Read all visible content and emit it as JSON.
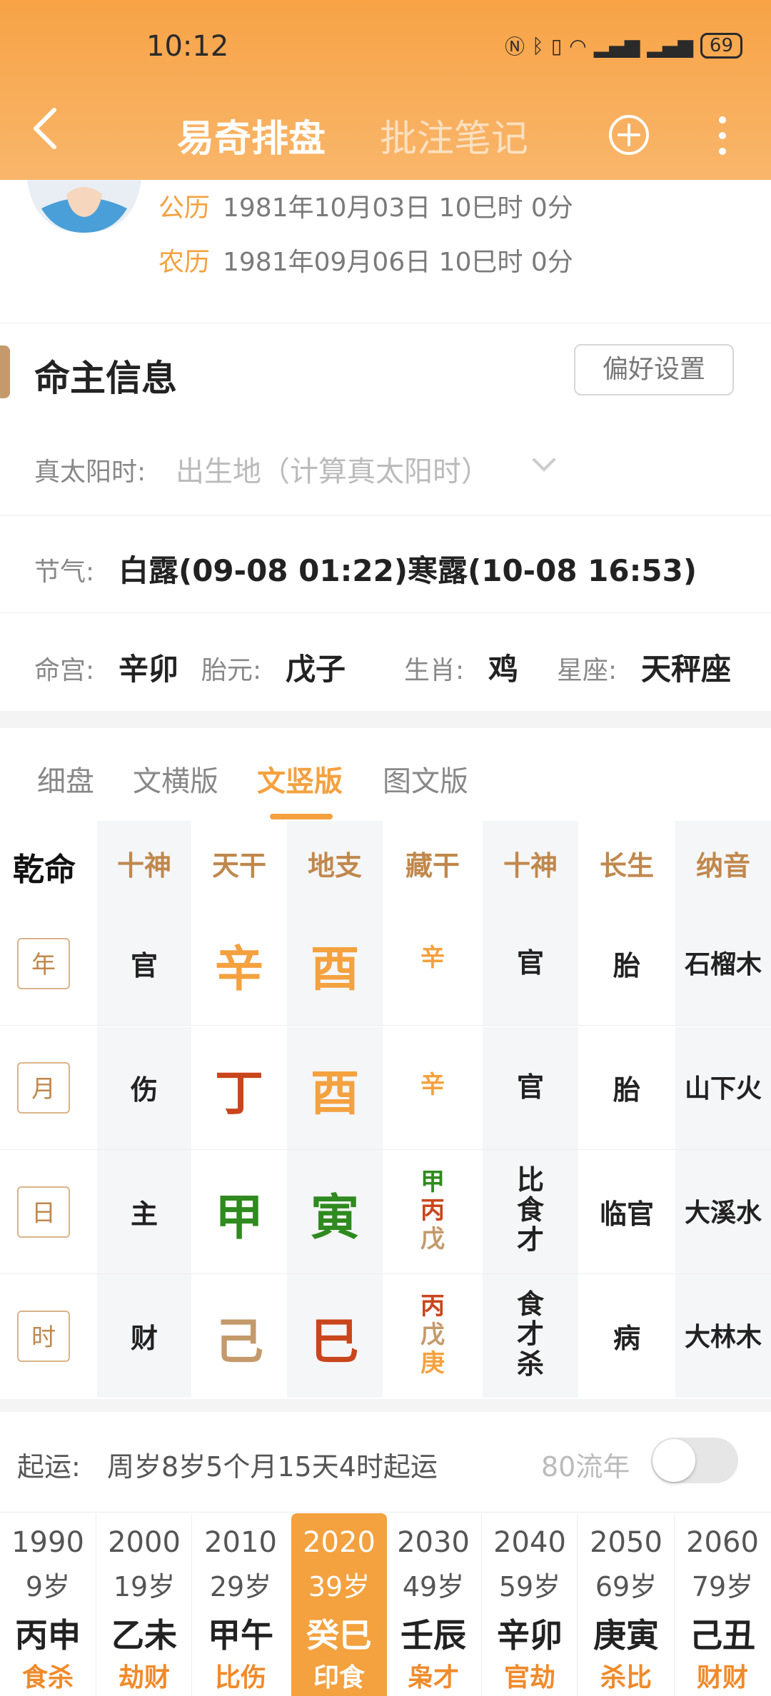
{
  "status": {
    "time": "10:12",
    "battery": "69"
  },
  "header": {
    "tab_active": "易奇排盘",
    "tab_inactive": "批注笔记"
  },
  "birth": {
    "solar_label": "公历",
    "solar_value": "1981年10月03日 10巳时 0分",
    "lunar_label": "农历",
    "lunar_value": "1981年09月06日 10巳时 0分"
  },
  "section": {
    "title": "命主信息",
    "pref_button": "偏好设置"
  },
  "true_solar": {
    "label": "真太阳时:",
    "placeholder": "出生地（计算真太阳时）"
  },
  "solar_term": {
    "label": "节气:",
    "value": "白露(09-08 01:22)寒露(10-08 16:53)"
  },
  "palace": {
    "minggong_label": "命宫:",
    "minggong_value": "辛卯",
    "taiyuan_label": "胎元:",
    "taiyuan_value": "戊子",
    "zodiac_label": "生肖:",
    "zodiac_value": "鸡",
    "constellation_label": "星座:",
    "constellation_value": "天秤座"
  },
  "view_tabs": [
    "细盘",
    "文横版",
    "文竖版",
    "图文版"
  ],
  "view_tab_active": 2,
  "chart": {
    "corner": "乾命",
    "headers": [
      "十神",
      "天干",
      "地支",
      "藏干",
      "十神",
      "长生",
      "纳音"
    ],
    "rows": [
      {
        "pillar": "年",
        "shishen": "官",
        "gan": "辛",
        "zhi": "酉",
        "canggan": [
          "辛"
        ],
        "cang_shishen": [
          "官"
        ],
        "changsheng": "胎",
        "nayin": "石榴木"
      },
      {
        "pillar": "月",
        "shishen": "伤",
        "gan": "丁",
        "zhi": "酉",
        "canggan": [
          "辛"
        ],
        "cang_shishen": [
          "官"
        ],
        "changsheng": "胎",
        "nayin": "山下火"
      },
      {
        "pillar": "日",
        "shishen": "主",
        "gan": "甲",
        "zhi": "寅",
        "canggan": [
          "甲",
          "丙",
          "戊"
        ],
        "cang_shishen": [
          "比",
          "食",
          "才"
        ],
        "changsheng": "临官",
        "nayin": "大溪水"
      },
      {
        "pillar": "时",
        "shishen": "财",
        "gan": "己",
        "zhi": "巳",
        "canggan": [
          "丙",
          "戊",
          "庚"
        ],
        "cang_shishen": [
          "食",
          "才",
          "杀"
        ],
        "changsheng": "病",
        "nayin": "大林木"
      }
    ],
    "colors": {
      "metal": "#f4a13f",
      "fire": "#c9461c",
      "wood": "#2f8a1f",
      "earth": "#c49a6c"
    }
  },
  "qiyun": {
    "label": "起运:",
    "value": "周岁8岁5个月15天4时起运",
    "toggle_label": "80流年",
    "toggle_on": false
  },
  "dayun": [
    {
      "year": "1990",
      "age": "9岁",
      "ganzhi": "丙申",
      "shishen": "食杀"
    },
    {
      "year": "2000",
      "age": "19岁",
      "ganzhi": "乙未",
      "shishen": "劫财"
    },
    {
      "year": "2010",
      "age": "29岁",
      "ganzhi": "甲午",
      "shishen": "比伤"
    },
    {
      "year": "2020",
      "age": "39岁",
      "ganzhi": "癸巳",
      "shishen": "印食"
    },
    {
      "year": "2030",
      "age": "49岁",
      "ganzhi": "壬辰",
      "shishen": "枭才"
    },
    {
      "year": "2040",
      "age": "59岁",
      "ganzhi": "辛卯",
      "shishen": "官劫"
    },
    {
      "year": "2050",
      "age": "69岁",
      "ganzhi": "庚寅",
      "shishen": "杀比"
    },
    {
      "year": "2060",
      "age": "79岁",
      "ganzhi": "己丑",
      "shishen": "财财"
    }
  ],
  "dayun_active": 3
}
